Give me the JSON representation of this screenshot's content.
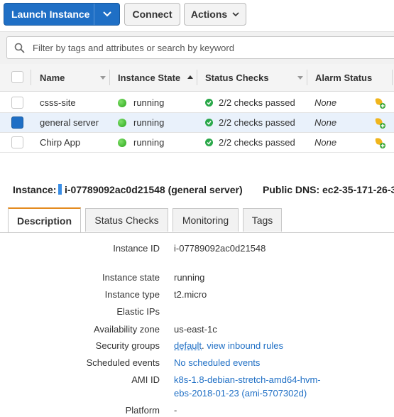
{
  "toolbar": {
    "launch_label": "Launch Instance",
    "connect_label": "Connect",
    "actions_label": "Actions"
  },
  "filter": {
    "placeholder": "Filter by tags and attributes or search by keyword"
  },
  "table": {
    "columns": [
      "Name",
      "Instance State",
      "Status Checks",
      "Alarm Status"
    ],
    "rows": [
      {
        "name": "csss-site",
        "state": "running",
        "checks": "2/2 checks passed",
        "alarm": "None",
        "selected": false
      },
      {
        "name": "general server",
        "state": "running",
        "checks": "2/2 checks passed",
        "alarm": "None",
        "selected": true
      },
      {
        "name": "Chirp App",
        "state": "running",
        "checks": "2/2 checks passed",
        "alarm": "None",
        "selected": false
      }
    ]
  },
  "infobar": {
    "instance_label": "Instance:",
    "instance_value": "i-07789092ac0d21548 (general server)",
    "dns_label": "Public DNS:",
    "dns_value": "ec2-35-171-26-3"
  },
  "tabs": [
    "Description",
    "Status Checks",
    "Monitoring",
    "Tags"
  ],
  "details": {
    "instance_id_label": "Instance ID",
    "instance_id": "i-07789092ac0d21548",
    "state_label": "Instance state",
    "state": "running",
    "type_label": "Instance type",
    "type": "t2.micro",
    "eip_label": "Elastic IPs",
    "az_label": "Availability zone",
    "az": "us-east-1c",
    "sg_label": "Security groups",
    "sg_link": "default",
    "sg_rules_link": "view inbound rules",
    "events_label": "Scheduled events",
    "events": "No scheduled events",
    "ami_label": "AMI ID",
    "ami_line1": "k8s-1.8-debian-stretch-amd64-hvm-",
    "ami_line2": "ebs-2018-01-23 (ami-5707302d)",
    "platform_label": "Platform",
    "platform": "-"
  },
  "colors": {
    "primary": "#1f6fc5",
    "running_green": "#2aa51a",
    "active_tab_accent": "#e48b1f"
  }
}
